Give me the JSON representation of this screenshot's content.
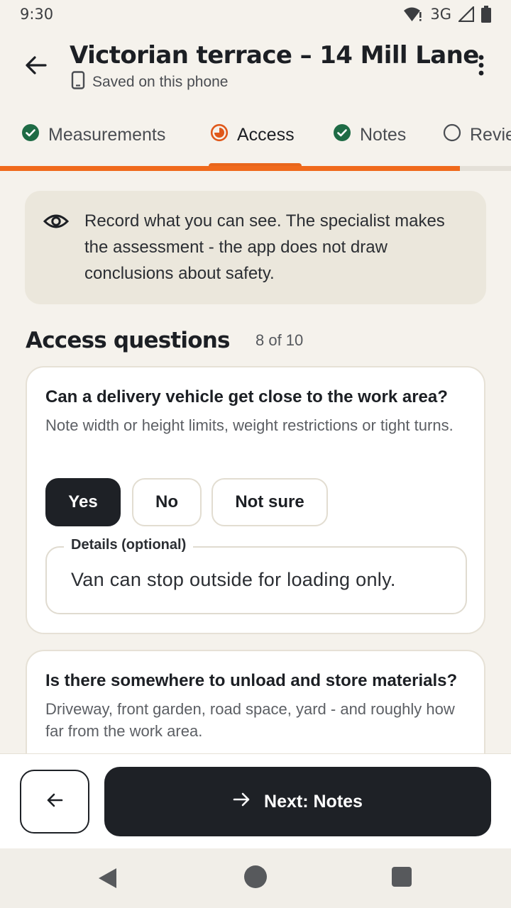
{
  "status_bar": {
    "time": "9:30",
    "network": "3G",
    "icons": [
      "wifi-alert-icon",
      "cell-signal-icon",
      "battery-icon"
    ]
  },
  "app_bar": {
    "back_icon": "arrow-left-icon",
    "title": "Victorian terrace – 14 Mill Lane",
    "subtitle": "Saved on this phone",
    "subtitle_icon": "phone-icon",
    "menu_icon": "more-vertical-icon"
  },
  "tabs": [
    {
      "label": "Measurements",
      "state": "complete",
      "icon": "check-circle-icon"
    },
    {
      "label": "Access",
      "state": "in-progress",
      "icon": "progress-circle-icon"
    },
    {
      "label": "Notes",
      "state": "complete",
      "icon": "check-circle-icon"
    },
    {
      "label": "Review",
      "state": "not-started",
      "icon": "empty-circle-icon"
    }
  ],
  "progress": {
    "fraction": 0.9
  },
  "info_card": {
    "icon": "eye-icon",
    "text": "Record what you can see. The specialist makes the assessment - the app does not draw conclusions about safety."
  },
  "section": {
    "title": "Access questions",
    "count": "8 of 10"
  },
  "questions": [
    {
      "title": "Can a delivery vehicle get close to the work area?",
      "hint": "Note width or height limits, weight restrictions or tight turns.",
      "options": [
        "Yes",
        "No",
        "Not sure"
      ],
      "selected": "Yes",
      "details_label": "Details (optional)",
      "details_value": "Van can stop outside for loading only."
    },
    {
      "title": "Is there somewhere to unload and store materials?",
      "hint": "Driveway, front garden, road space, yard - and roughly how far from the work area."
    }
  ],
  "actions": {
    "previous_icon": "arrow-left-icon",
    "next_icon": "arrow-right-icon",
    "next_label": "Next: Notes"
  },
  "colors": {
    "accent": "#f06a1c",
    "complete": "#1e6b45",
    "dark": "#1e2126",
    "background": "#f5f2ec"
  }
}
